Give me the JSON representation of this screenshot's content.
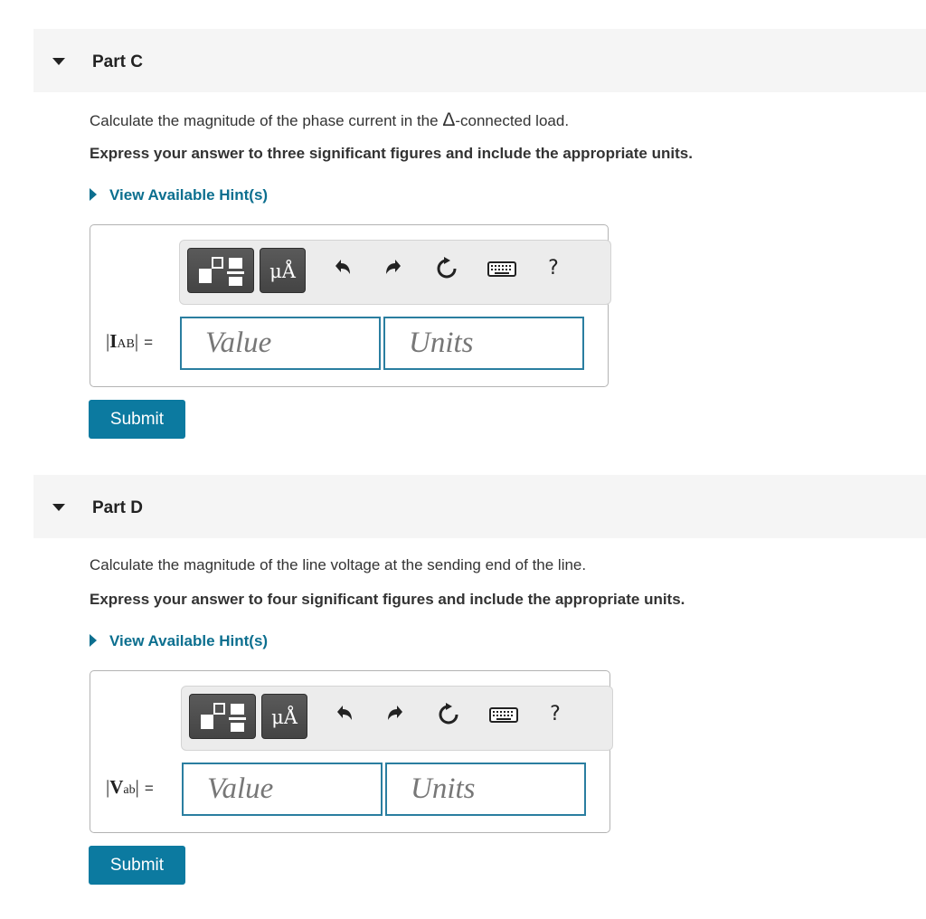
{
  "parts": [
    {
      "title": "Part C",
      "question_prefix": "Calculate the magnitude of the phase current in the ",
      "delta_symbol": "Δ",
      "question_suffix": "-connected load.",
      "instruction": "Express your answer to three significant figures and include the appropriate units.",
      "hint_label": "View Available Hint(s)",
      "variable": {
        "letter": "I",
        "subscript": "AB",
        "equals": "="
      },
      "value_placeholder": "Value",
      "units_placeholder": "Units",
      "submit_label": "Submit"
    },
    {
      "title": "Part D",
      "question": "Calculate the magnitude of the line voltage at the sending end of the line.",
      "instruction": "Express your answer to four significant figures and include the appropriate units.",
      "hint_label": "View Available Hint(s)",
      "variable": {
        "letter": "V",
        "subscript": "ab",
        "equals": "="
      },
      "value_placeholder": "Value",
      "units_placeholder": "Units",
      "submit_label": "Submit"
    }
  ],
  "toolbar": {
    "units_button_label": "μÅ",
    "help_label": "?",
    "icons": [
      "templates-icon",
      "units-icon",
      "undo-icon",
      "redo-icon",
      "reset-icon",
      "keyboard-icon",
      "help-icon"
    ]
  },
  "colors": {
    "accent": "#0c7aa0",
    "hint": "#0c6f8f",
    "field_border": "#2a7ea0",
    "header_bg": "#f5f5f5"
  }
}
